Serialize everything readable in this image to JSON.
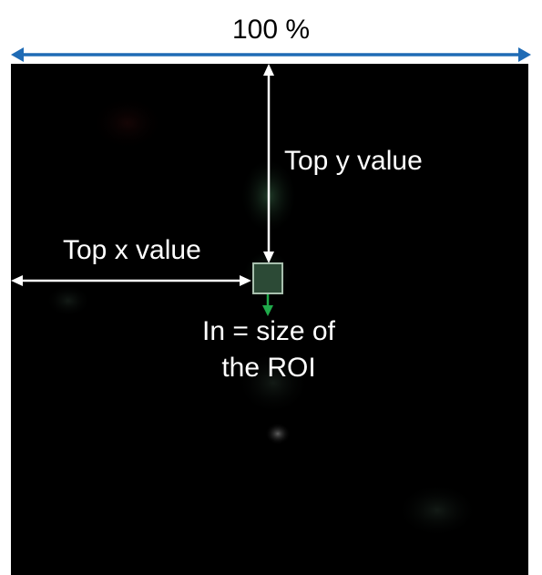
{
  "width_label": "100 %",
  "top_y_label": "Top y value",
  "top_x_label": "Top x value",
  "roi_size_label": "In = size of the ROI",
  "colors": {
    "image_background": "#000000",
    "width_arrow": "#1f6bb5",
    "offset_arrows": "#ffffff",
    "roi_box_border": "#a8c0ae",
    "roi_box_fill": "#2c4a36",
    "roi_size_arrow": "#1faa4a"
  }
}
